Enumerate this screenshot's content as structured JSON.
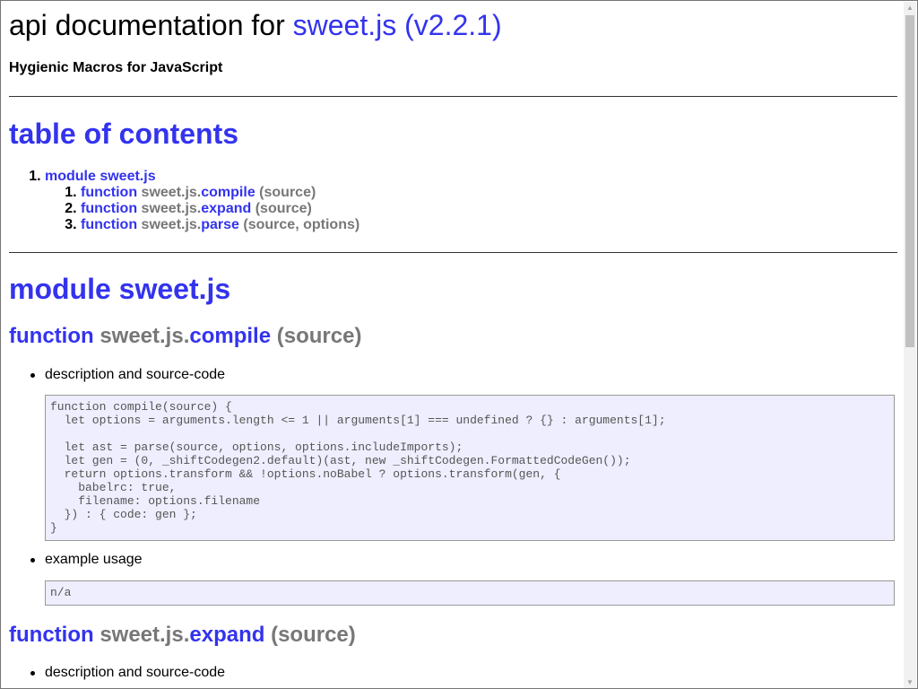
{
  "header": {
    "title_prefix": "api documentation for ",
    "title_link": "sweet.js (v2.2.1)",
    "subtitle": "Hygienic Macros for JavaScript"
  },
  "toc": {
    "heading": "table of contents",
    "module": "module sweet.js",
    "items": [
      {
        "keyword": "function",
        "ns": "sweet.js.",
        "name": "compile",
        "sig": "(source)"
      },
      {
        "keyword": "function",
        "ns": "sweet.js.",
        "name": "expand",
        "sig": "(source)"
      },
      {
        "keyword": "function",
        "ns": "sweet.js.",
        "name": "parse",
        "sig": "(source, options)"
      }
    ]
  },
  "module": {
    "heading": "module sweet.js"
  },
  "functions": [
    {
      "keyword": "function",
      "ns": "sweet.js.",
      "name": "compile",
      "sig": "(source)",
      "desc_label": "description and source-code",
      "code": "function compile(source) {\n  let options = arguments.length <= 1 || arguments[1] === undefined ? {} : arguments[1];\n\n  let ast = parse(source, options, options.includeImports);\n  let gen = (0, _shiftCodegen2.default)(ast, new _shiftCodegen.FormattedCodeGen());\n  return options.transform && !options.noBabel ? options.transform(gen, {\n    babelrc: true,\n    filename: options.filename\n  }) : { code: gen };\n}",
      "usage_label": "example usage",
      "usage": "n/a"
    },
    {
      "keyword": "function",
      "ns": "sweet.js.",
      "name": "expand",
      "sig": "(source)",
      "desc_label": "description and source-code"
    }
  ],
  "colors": {
    "link": "#3333ee",
    "muted": "#777777",
    "code_bg": "#eeeeff"
  }
}
